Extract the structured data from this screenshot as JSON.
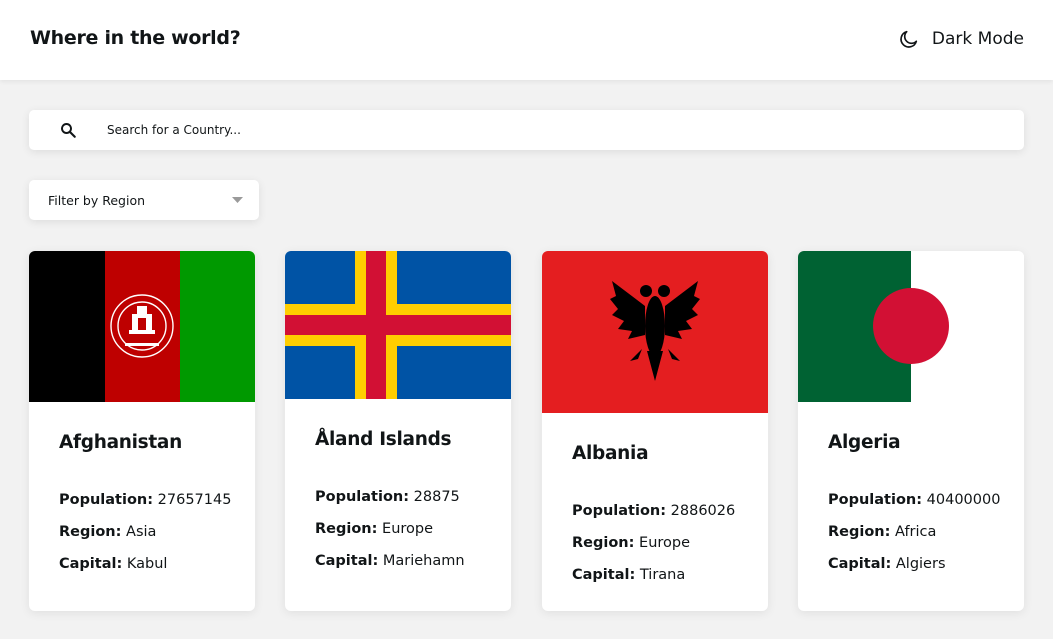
{
  "header": {
    "title": "Where in the world?",
    "mode_toggle": {
      "label": "Dark Mode",
      "icon": "moon-icon"
    }
  },
  "search": {
    "placeholder": "Search for a Country...",
    "value": "",
    "icon": "search-icon"
  },
  "filter": {
    "label": "Filter by Region",
    "icon": "caret-down-icon"
  },
  "labels": {
    "population": "Population:",
    "region": "Region:",
    "capital": "Capital:"
  },
  "countries": [
    {
      "name": "Afghanistan",
      "population": "27657145",
      "region": "Asia",
      "capital": "Kabul",
      "flag_colors": [
        "#000000",
        "#be0000",
        "#009900",
        "#ffffff"
      ]
    },
    {
      "name": "Åland Islands",
      "population": "28875",
      "region": "Europe",
      "capital": "Mariehamn",
      "flag_colors": [
        "#0053a5",
        "#ffce00",
        "#d21034"
      ]
    },
    {
      "name": "Albania",
      "population": "2886026",
      "region": "Europe",
      "capital": "Tirana",
      "flag_colors": [
        "#e41e20",
        "#000000"
      ]
    },
    {
      "name": "Algeria",
      "population": "40400000",
      "region": "Africa",
      "capital": "Algiers",
      "flag_colors": [
        "#006233",
        "#ffffff",
        "#d21034"
      ]
    }
  ]
}
